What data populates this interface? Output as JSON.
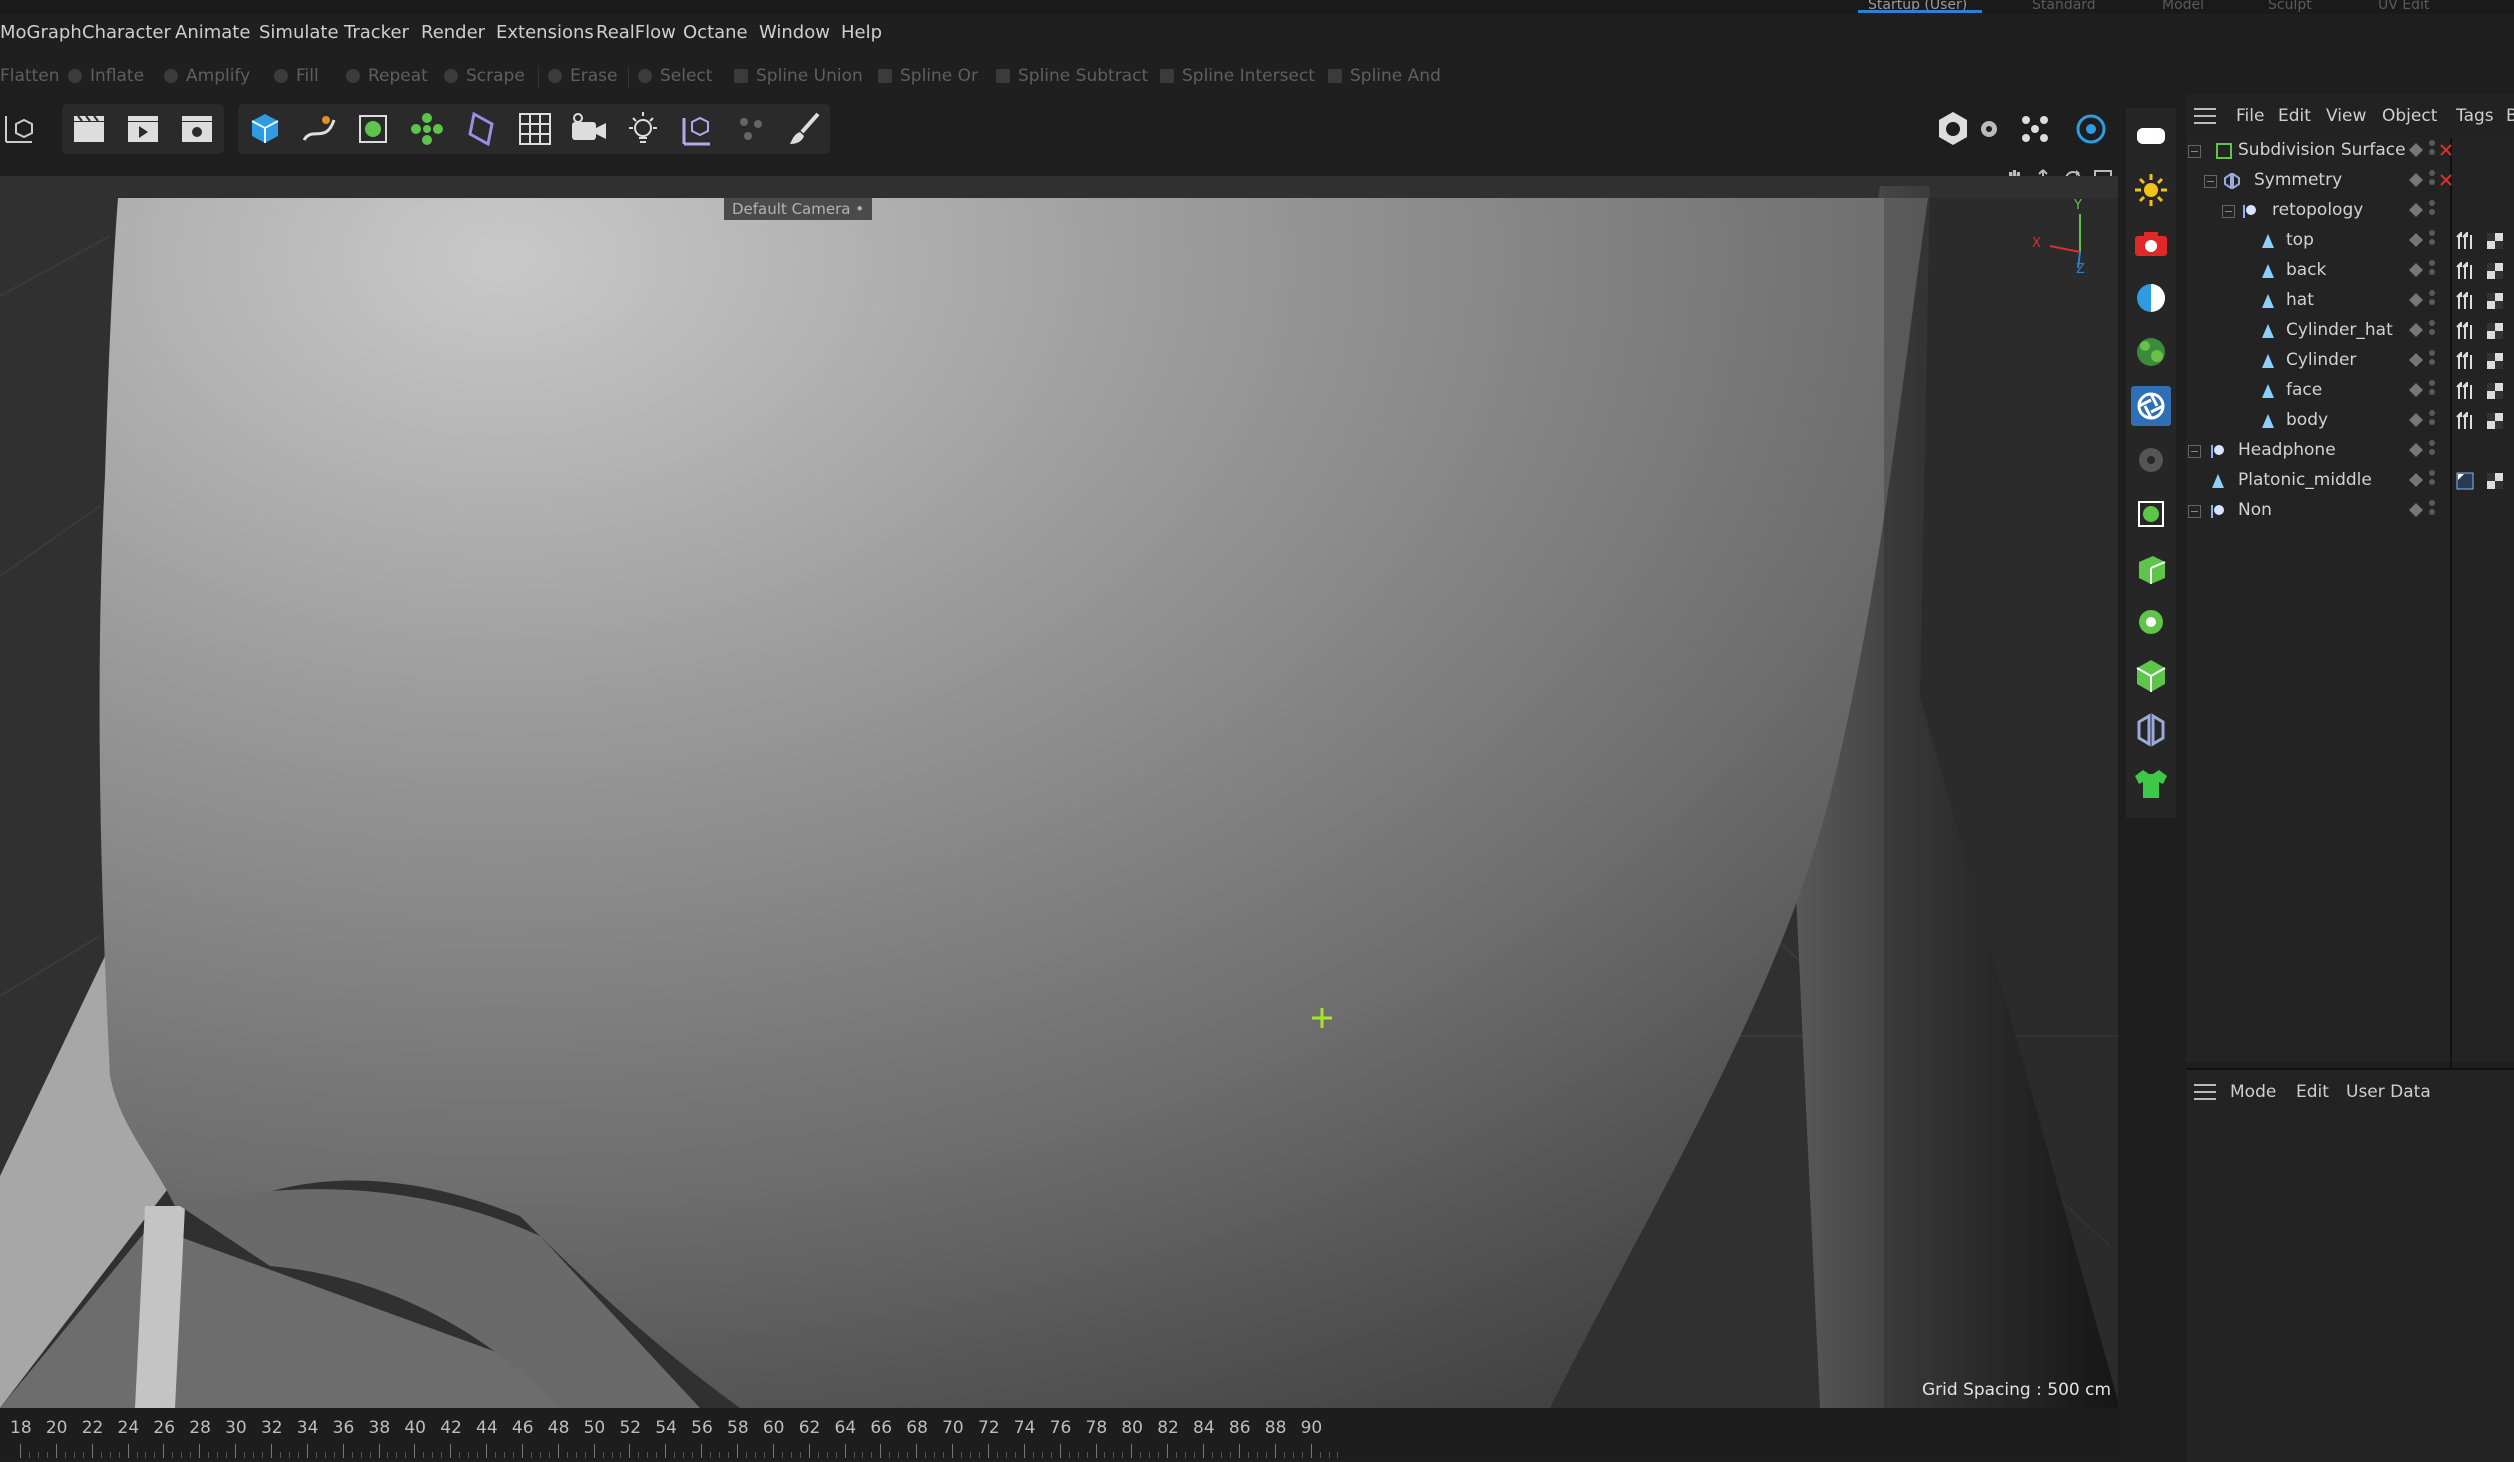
{
  "layout_tabs": [
    "Startup (User)",
    "Standard",
    "Model",
    "Sculpt",
    "UV Edit"
  ],
  "menubar": [
    "MoGraph",
    "Character",
    "Animate",
    "Simulate",
    "Tracker",
    "Render",
    "Extensions",
    "RealFlow",
    "Octane",
    "Window",
    "Help"
  ],
  "command_bar": [
    "Flatten",
    "Inflate",
    "Amplify",
    "Fill",
    "Repeat",
    "Scrape",
    "Erase",
    "Select",
    "Spline Union",
    "Spline Or",
    "Spline Subtract",
    "Spline Intersect",
    "Spline And"
  ],
  "viewport": {
    "camera_label": "Default Camera",
    "camera_suffix": "•",
    "grid_spacing": "Grid Spacing : 500 cm",
    "axis_y": "Y",
    "axis_x": "X",
    "axis_z": "Z"
  },
  "timeline": {
    "ticks": [
      "18",
      "20",
      "22",
      "24",
      "26",
      "28",
      "30",
      "32",
      "34",
      "36",
      "38",
      "40",
      "42",
      "44",
      "46",
      "48",
      "50",
      "52",
      "54",
      "56",
      "58",
      "60",
      "62",
      "64",
      "66",
      "68",
      "70",
      "72",
      "74",
      "76",
      "78",
      "80",
      "82",
      "84",
      "86",
      "88",
      "90"
    ]
  },
  "object_manager": {
    "menu": [
      "File",
      "Edit",
      "View",
      "Object",
      "Tags",
      "B"
    ],
    "objects": [
      {
        "name": "Subdivision Surface",
        "icon": "subdivision-icon"
      },
      {
        "name": "Symmetry",
        "icon": "symmetry-icon"
      },
      {
        "name": "retopology",
        "icon": "null-icon"
      },
      {
        "name": "top",
        "icon": "polygon-icon"
      },
      {
        "name": "back",
        "icon": "polygon-icon"
      },
      {
        "name": "hat",
        "icon": "polygon-icon"
      },
      {
        "name": "Cylinder_hat",
        "icon": "polygon-icon"
      },
      {
        "name": "Cylinder",
        "icon": "polygon-icon"
      },
      {
        "name": "face",
        "icon": "polygon-icon"
      },
      {
        "name": "body",
        "icon": "polygon-icon"
      },
      {
        "name": "Headphone",
        "icon": "null-icon"
      },
      {
        "name": "Platonic_middle",
        "icon": "polygon-icon"
      },
      {
        "name": "Non",
        "icon": "null-icon"
      }
    ]
  },
  "attribute_manager": {
    "menu": [
      "Mode",
      "Edit",
      "User Data"
    ]
  },
  "colors": {
    "accent": "#2f7fd8",
    "cursor": "#a6e22e",
    "delete_x": "#d9302b"
  }
}
